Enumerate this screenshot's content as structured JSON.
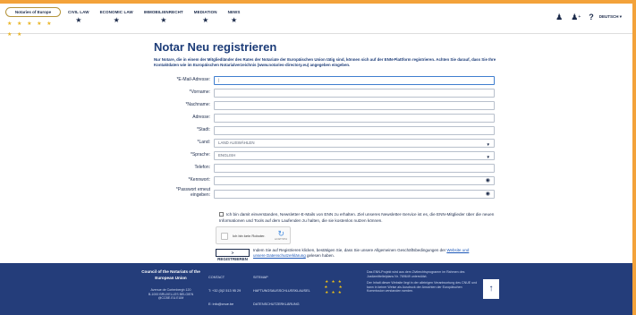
{
  "header": {
    "logo_title": "Notaries of Europe",
    "logo_stars": "★ ★ ★ ★ ★ ★ ★",
    "nav": [
      {
        "label": "CIVIL LAW"
      },
      {
        "label": "ECONOMIC LAW"
      },
      {
        "label": "IMMOBILIENRECHT"
      },
      {
        "label": "MEDIATION"
      },
      {
        "label": "NEWS"
      }
    ],
    "language": "DEUTSCH ▾"
  },
  "main": {
    "title": "Notar Neu registrieren",
    "intro": "Nur Notare, die in einem der Mitgliedländer des Rates der Notariate der Europäischen Union tätig sind, können sich auf der ENN-Plattform registrieren. Achten Sie darauf, dass Sie Ihre Kontaktdaten wie im Europäischen Notarialverzeichnis (www.notaries-directory.eu) angegeben eingeben."
  },
  "form": {
    "fields": [
      {
        "label": "*E-Mail-Adresse:",
        "value": "|"
      },
      {
        "label": "*Vorname:",
        "value": ""
      },
      {
        "label": "*Nachname:",
        "value": ""
      },
      {
        "label": "Adresse:",
        "value": ""
      },
      {
        "label": "*Stadt:",
        "value": ""
      },
      {
        "label": "*Land:",
        "value": "LAND AUSWÄHLEN"
      },
      {
        "label": "*Sprache:",
        "value": "ENGLISH"
      },
      {
        "label": "Telefon:",
        "value": ""
      },
      {
        "label": "*Kennwort:",
        "value": ""
      },
      {
        "label": "*Passwort erneut eingeben:",
        "value": ""
      }
    ],
    "newsletter": "Ich bin damit einverstanden, Newsletter-E-Mails von ENN zu erhalten. Ziel unseres Newsletter-Service ist es, die ENN-Mitglieder über die neuen Informationen und Tools auf dem Laufenden zu halten, die sie kostenlos nutzen können.",
    "captcha_text": "Ich bin kein Roboter.",
    "captcha_brand": "reCAPTCHA",
    "register_label": "> REGISTRIEREN",
    "terms_text": "Indem Sie auf Registrieren klicken, bestätigen Sie, dass Sie unsere Allgemeinen Geschäftsbedingungen der ",
    "terms_link1": "Website und",
    "terms_link2": "unsere Datenschutzerklärung",
    "terms_end": " gelesen haben."
  },
  "footer": {
    "council": "Council of the Notariats of the European Union",
    "council_name": "the European Union",
    "address": "Avenue de Cortenbergh 120\nB-1000 BRUXELLES BELGIEN\n@CCBE.EU.EUM",
    "contact": "CONTACT",
    "phone": "T: +32 (0)2 513 95 29",
    "email": "E: info@cnue.be",
    "sitemap": "SITEMAP",
    "liability": "HAFTUNGSAUSSCHLUSSKLAUSEL",
    "privacy": "DATENSCHUTZERKLÄRUNG",
    "flag_stars": "★ ★ ★\n★     ★\n★ ★ ★",
    "disc1": "Das ENN-Projekt wird aus dem Zivilrechtsprogramm im Rahmen des Justizmitteltelplans Nr. 769649 unterstützt.",
    "disc2": "Der Inhalt dieser Website liegt in der alleinigen Verantwortung des CNUE und kann in keiner Weise als Ausdruck der Ansichten der Europäischen Kommission verstanden werden.",
    "up": "↑"
  },
  "colors": {
    "accent": "#f3a23a",
    "footer_bg": "#243d7a",
    "title": "#1c3c78"
  }
}
